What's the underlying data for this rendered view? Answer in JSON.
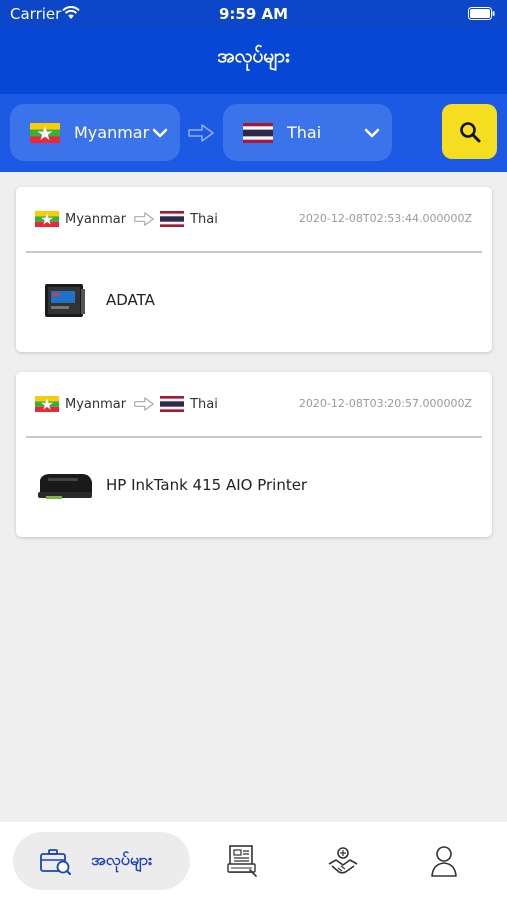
{
  "status_bar": {
    "carrier": "Carrier",
    "time": "9:59 AM"
  },
  "header": {
    "title": "အလုပ်များ"
  },
  "filter": {
    "from_country": "Myanmar",
    "to_country": "Thai",
    "from_flag": "myanmar-flag",
    "to_flag": "thailand-flag",
    "search_icon": "search-icon"
  },
  "orders": [
    {
      "from": "Myanmar",
      "to": "Thai",
      "timestamp": "2020-12-08T02:53:44.000000Z",
      "product": "ADATA",
      "thumb": "ssd-drive-image"
    },
    {
      "from": "Myanmar",
      "to": "Thai",
      "timestamp": "2020-12-08T03:20:57.000000Z",
      "product": "HP InkTank 415 AIO Printer",
      "thumb": "printer-image"
    }
  ],
  "tabs": {
    "active_label": "အလုပ်များ",
    "items": [
      "jobs-icon",
      "submit-icon",
      "handshake-icon",
      "profile-icon"
    ]
  },
  "colors": {
    "header": "#0747d6",
    "filter_bar": "#1d5ae4",
    "select_bg": "#3b74ea",
    "search_button": "#f5de1f",
    "active_tab_text": "#1c44b8"
  }
}
